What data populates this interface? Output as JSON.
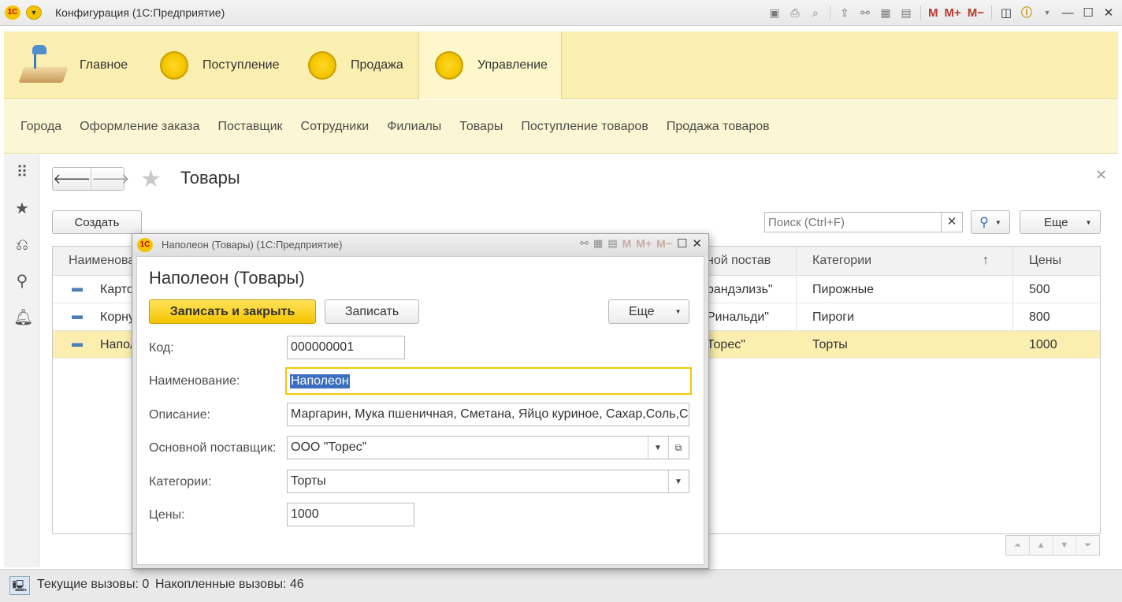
{
  "window": {
    "title": "Конфигурация  (1С:Предприятие)",
    "logo_text": "1С",
    "toolbar": {
      "m": "M",
      "m_plus": "M+",
      "m_minus": "M−"
    }
  },
  "sections": [
    {
      "label": "Главное",
      "icon": "desk-lamp-icon"
    },
    {
      "label": "Поступление",
      "icon": "yellow-circle-icon"
    },
    {
      "label": "Продажа",
      "icon": "yellow-circle-icon"
    },
    {
      "label": "Управление",
      "icon": "yellow-circle-icon",
      "active": true
    }
  ],
  "nav": [
    "Города",
    "Оформление заказа",
    "Поставщик",
    "Сотрудники",
    "Филиалы",
    "Товары",
    "Поступление товаров",
    "Продажа товаров"
  ],
  "form": {
    "title": "Товары",
    "create_label": "Создать",
    "search_placeholder": "Поиск (Ctrl+F)",
    "more_label": "Еще",
    "columns": [
      "Наименова",
      "ной постав",
      "Категории",
      "Цены"
    ],
    "sort_indicator": "↑",
    "rows": [
      {
        "name": "Карто",
        "supplier": "рандэлизь\"",
        "category": "Пирожные",
        "price": "500",
        "selected": false
      },
      {
        "name": "Корну",
        "supplier": "Ринальди\"",
        "category": "Пироги",
        "price": "800",
        "selected": false
      },
      {
        "name": "Напол",
        "supplier": "Торес\"",
        "category": "Торты",
        "price": "1000",
        "selected": true
      }
    ]
  },
  "modal": {
    "window_title": "Наполеон (Товары)  (1С:Предприятие)",
    "heading": "Наполеон (Товары)",
    "save_close_label": "Записать и закрыть",
    "save_label": "Записать",
    "more_label": "Еще",
    "fields": {
      "code_label": "Код:",
      "code_value": "000000001",
      "name_label": "Наименование:",
      "name_value": "Наполеон",
      "desc_label": "Описание:",
      "desc_value": "Маргарин, Мука пшеничная,  Сметана, Яйцо куриное, Сахар,Соль,Сахар",
      "supplier_label": "Основной поставщик:",
      "supplier_value": "ООО \"Торес\"",
      "category_label": "Категории:",
      "category_value": "Торты",
      "price_label": "Цены:",
      "price_value": "1000"
    }
  },
  "status": {
    "current_calls": "Текущие вызовы: 0",
    "accumulated_calls": "Накопленные вызовы: 46"
  }
}
